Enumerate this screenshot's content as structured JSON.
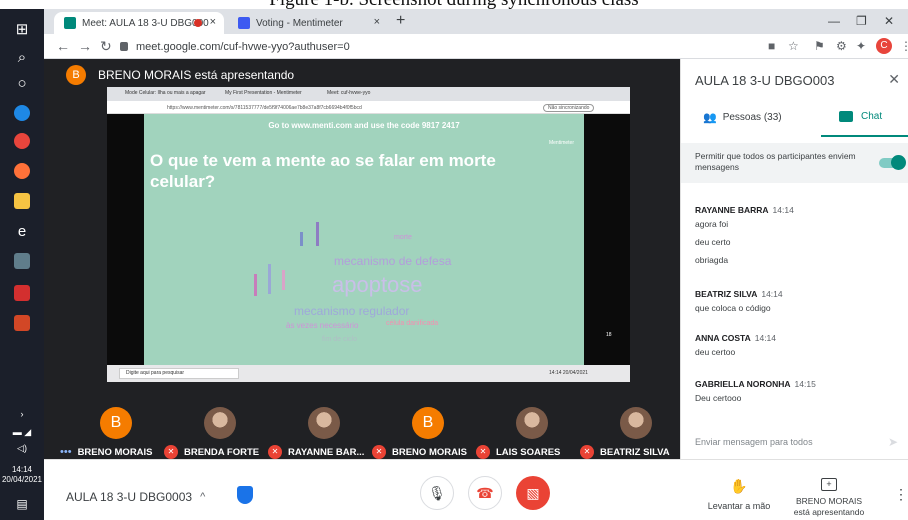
{
  "caption": "Figure 1-b. Screenshot during synchronous class",
  "browser": {
    "tabs": [
      {
        "title": "Meet: AULA 18 3-U DBG000",
        "active": true
      },
      {
        "title": "Voting - Mentimeter",
        "active": false
      }
    ],
    "url": "meet.google.com/cuf-hvwe-yyo?authuser=0",
    "profile_initial": "C"
  },
  "taskbar": {
    "date_time": [
      "14:14",
      "20/04/2021"
    ]
  },
  "presenter": {
    "initial": "B",
    "banner": "BRENO MORAIS está apresentando"
  },
  "shared_screen": {
    "inner_tabs": [
      "Mode Celular: Ilha ou mais a apagar",
      "My First Presentation - Mentimeter",
      "Meet: cuf-hvwe-yyo"
    ],
    "inner_url": "https://www.mentimeter.com/s/7811537777/de5f9f74006ae7b8e37a8f7cb6694b4f0f5bcd",
    "inner_profile": "Não sincronizando",
    "instruction": "Go to www.menti.com and use the code 9817 2417",
    "brand": "Mentimeter",
    "question": "O que te vem a mente ao se falar em morte celular?",
    "words": {
      "main": "apoptose",
      "w1": "mecanismo de defesa",
      "w2": "mecanismo regulador",
      "w3": "às vezes necessário",
      "w4": "célula danificada",
      "w5": "fim de ciclo",
      "w6": "morte"
    },
    "slide_counter": "18",
    "inner_search": "Digite aqui para pesquisar",
    "inner_clock": "14:14 20/04/2021"
  },
  "participants": [
    {
      "name": "BRENO MORAIS",
      "initial": "B",
      "muted": false,
      "more": true
    },
    {
      "name": "BRENDA FORTE",
      "initial": "",
      "muted": true
    },
    {
      "name": "RAYANNE BAR...",
      "initial": "",
      "muted": true
    },
    {
      "name": "BRENO MORAIS",
      "initial": "B",
      "muted": true
    },
    {
      "name": "LAIS SOARES",
      "initial": "",
      "muted": true
    },
    {
      "name": "BEATRIZ SILVA",
      "initial": "",
      "muted": true
    }
  ],
  "panel": {
    "title": "AULA 18 3-U DBGO003",
    "people_tab": "Pessoas (33)",
    "chat_tab": "Chat",
    "permission": "Permitir que todos os participantes enviem mensagens",
    "toggle_on": true,
    "messages": [
      {
        "sender": "RAYANNE BARRA",
        "time": "14:14",
        "lines": [
          "agora foi",
          "deu certo",
          "obriagda"
        ]
      },
      {
        "sender": "BEATRIZ SILVA",
        "time": "14:14",
        "lines": [
          "que coloca o código"
        ]
      },
      {
        "sender": "ANNA COSTA",
        "time": "14:14",
        "lines": [
          "deu certoo"
        ]
      },
      {
        "sender": "GABRIELLA NORONHA",
        "time": "14:15",
        "lines": [
          "Deu certooo"
        ]
      }
    ],
    "input_placeholder": "Enviar mensagem para todos"
  },
  "bottom": {
    "meeting_name": "AULA 18 3-U DBG0003",
    "raise_hand": "Levantar a mão",
    "presenting": [
      "BRENO MORAIS",
      "está apresentando"
    ]
  },
  "colors": {
    "accent_green": "#00897b",
    "slide_bg": "#a1d3bd",
    "red": "#ea4335",
    "orange_avatar": "#f57c00"
  }
}
